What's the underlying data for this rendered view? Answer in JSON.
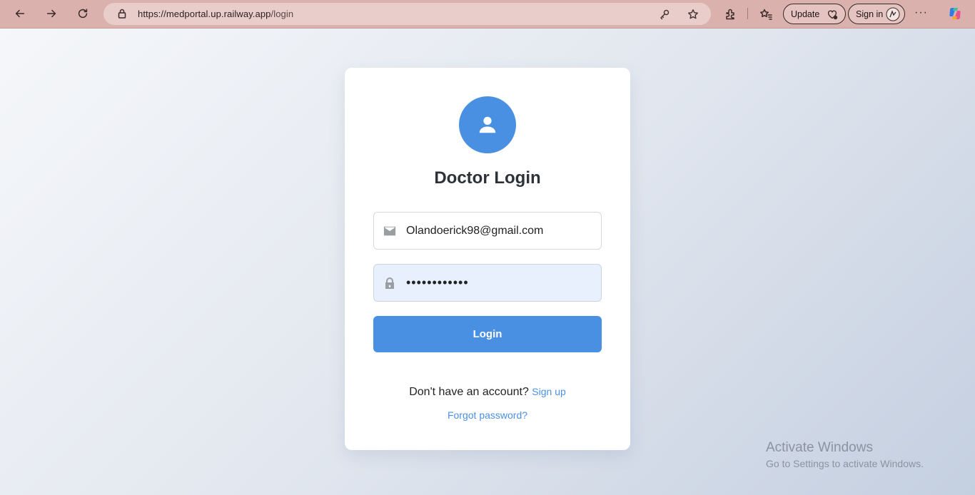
{
  "browser": {
    "url_host": "https://medportal.up.railway.app",
    "url_path": "/login",
    "update_label": "Update",
    "signin_label": "Sign in"
  },
  "login": {
    "title": "Doctor Login",
    "email_value": "Olandoerick98@gmail.com",
    "password_value": "••••••••••••",
    "login_label": "Login",
    "no_account_text": "Don't have an account?",
    "signup_link": "Sign up",
    "forgot_link": "Forgot password?"
  },
  "watermark": {
    "line1": "Activate Windows",
    "line2": "Go to Settings to activate Windows."
  },
  "colors": {
    "accent": "#4a90e2",
    "browser_bar": "#dbb1ad"
  }
}
